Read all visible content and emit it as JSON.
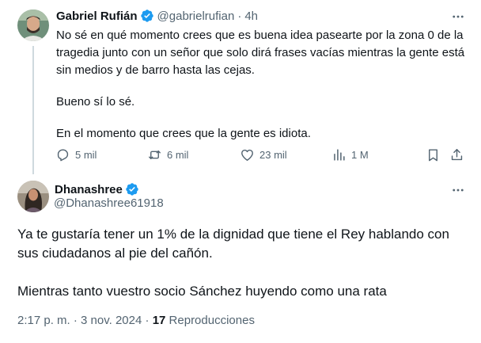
{
  "parent_tweet": {
    "author_name": "Gabriel Rufián",
    "handle": "@gabrielrufian",
    "separator": "·",
    "time": "4h",
    "text": [
      "No sé en qué momento crees que es buena idea pasearte por la zona 0 de la tragedia junto con un señor que solo dirá frases vacías mientras la gente está sin medios y de barro hasta las cejas.",
      "Bueno sí lo sé.",
      "En el momento que crees que la gente es idiota."
    ],
    "actions": {
      "replies": "5 mil",
      "reposts": "6 mil",
      "likes": "23 mil",
      "views": "1 M"
    }
  },
  "reply_tweet": {
    "author_name": "Dhanashree",
    "handle": "@Dhanashree61918",
    "text": [
      "Ya te gustaría tener un 1% de la dignidad que tiene el Rey hablando con sus ciudadanos al pie del cañón.",
      "Mientras tanto vuestro socio Sánchez huyendo como una rata"
    ],
    "time": "2:17 p. m.",
    "date": "3 nov. 2024",
    "separator": "·",
    "views_count": "17",
    "views_label": "Reproducciones"
  },
  "icons": {
    "verified": "verified-badge-icon",
    "more": "more-horizontal-icon",
    "reply": "reply-icon",
    "repost": "repost-icon",
    "like": "heart-icon",
    "views": "analytics-icon",
    "bookmark": "bookmark-icon",
    "share": "share-icon"
  },
  "colors": {
    "verified_blue": "#1d9bf0",
    "text_primary": "#0f1419",
    "text_secondary": "#536471",
    "thread_line": "#cfd9de"
  }
}
